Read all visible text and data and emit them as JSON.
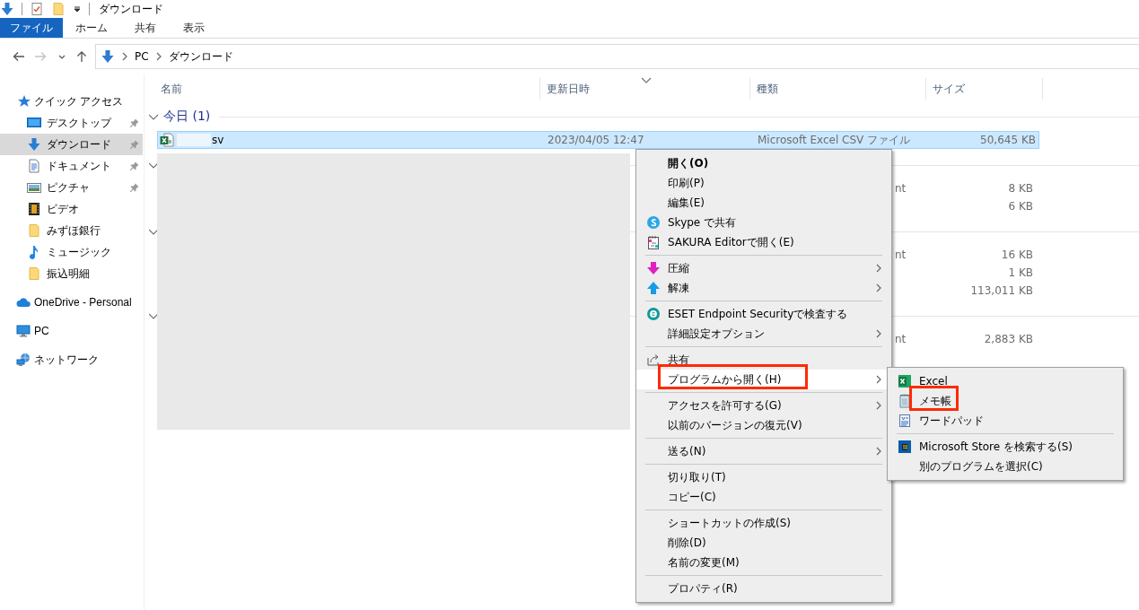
{
  "window": {
    "title": "ダウンロード"
  },
  "ribbon_tabs": [
    {
      "label": "ファイル",
      "selected": true
    },
    {
      "label": "ホーム",
      "selected": false
    },
    {
      "label": "共有",
      "selected": false
    },
    {
      "label": "表示",
      "selected": false
    }
  ],
  "navigation": [
    {
      "kind": "back",
      "disabled": false
    },
    {
      "kind": "forward",
      "disabled": true
    },
    {
      "kind": "recent",
      "disabled": false
    },
    {
      "kind": "up",
      "disabled": false
    }
  ],
  "address_bar": {
    "path": [
      "PC",
      "ダウンロード"
    ]
  },
  "sidebar": {
    "items": [
      {
        "label": "クイック アクセス",
        "selected": false,
        "children": [
          {
            "label": "デスクトップ",
            "selected": false,
            "pinned": true
          },
          {
            "label": "ダウンロード",
            "selected": true,
            "pinned": true
          },
          {
            "label": "ドキュメント",
            "selected": false,
            "pinned": true
          },
          {
            "label": "ピクチャ",
            "selected": false,
            "pinned": true
          },
          {
            "label": "ビデオ",
            "selected": false,
            "pinned": false
          },
          {
            "label": "みずほ銀行",
            "selected": false,
            "pinned": false
          },
          {
            "label": "ミュージック",
            "selected": false,
            "pinned": false
          },
          {
            "label": "振込明細",
            "selected": false,
            "pinned": false
          }
        ]
      },
      {
        "label": "OneDrive - Personal",
        "selected": false
      },
      {
        "label": "PC",
        "selected": false
      },
      {
        "label": "ネットワーク",
        "selected": false
      }
    ]
  },
  "table": {
    "columns": [
      "名前",
      "更新日時",
      "種類",
      "サイズ"
    ],
    "groups": [
      {
        "label": "今日 (1)",
        "expanded": true,
        "files": [
          {
            "kind": "full",
            "name": "sv",
            "modified": "2023/04/05 12:47",
            "type": "Microsoft Excel CSV ファイル",
            "size": "50,645 KB",
            "selected": true
          }
        ]
      },
      {
        "expanded": true,
        "files": [
          {
            "kind": "partial",
            "type": "nt",
            "size": "8 KB"
          },
          {
            "kind": "partial",
            "size": "6 KB"
          }
        ]
      },
      {
        "expanded": true,
        "files": [
          {
            "kind": "partial",
            "type": "nt",
            "size": "16 KB"
          },
          {
            "kind": "partial",
            "size": "1 KB"
          },
          {
            "kind": "partial",
            "size": "113,011 KB"
          }
        ]
      },
      {
        "expanded": true,
        "files": [
          {
            "kind": "partial",
            "type": "nt",
            "size": "2,883 KB"
          }
        ]
      }
    ]
  },
  "context_menu": {
    "items": [
      {
        "kind": "item",
        "label": "開く(O)",
        "default": true,
        "submenu": false,
        "hovered": false,
        "annotated": false
      },
      {
        "kind": "item",
        "label": "印刷(P)",
        "default": false,
        "submenu": false,
        "hovered": false,
        "annotated": false
      },
      {
        "kind": "item",
        "label": "編集(E)",
        "default": false,
        "submenu": false,
        "hovered": false,
        "annotated": false
      },
      {
        "kind": "item",
        "label": "Skype で共有",
        "default": false,
        "submenu": false,
        "hovered": false,
        "annotated": false
      },
      {
        "kind": "item",
        "label": "SAKURA Editorで開く(E)",
        "default": false,
        "submenu": false,
        "hovered": false,
        "annotated": false
      },
      {
        "kind": "separator"
      },
      {
        "kind": "item",
        "label": "圧縮",
        "default": false,
        "submenu": true,
        "hovered": false,
        "annotated": false
      },
      {
        "kind": "item",
        "label": "解凍",
        "default": false,
        "submenu": true,
        "hovered": false,
        "annotated": false
      },
      {
        "kind": "separator"
      },
      {
        "kind": "item",
        "label": "ESET Endpoint Securityで検査する",
        "default": false,
        "submenu": false,
        "hovered": false,
        "annotated": false
      },
      {
        "kind": "item",
        "label": "詳細設定オプション",
        "default": false,
        "submenu": true,
        "hovered": false,
        "annotated": false
      },
      {
        "kind": "separator"
      },
      {
        "kind": "item",
        "label": "共有",
        "default": false,
        "submenu": false,
        "hovered": false,
        "annotated": false
      },
      {
        "kind": "item",
        "label": "プログラムから開く(H)",
        "default": false,
        "submenu": true,
        "hovered": true,
        "annotated": true
      },
      {
        "kind": "separator"
      },
      {
        "kind": "item",
        "label": "アクセスを許可する(G)",
        "default": false,
        "submenu": true,
        "hovered": false,
        "annotated": false
      },
      {
        "kind": "item",
        "label": "以前のバージョンの復元(V)",
        "default": false,
        "submenu": false,
        "hovered": false,
        "annotated": false
      },
      {
        "kind": "separator"
      },
      {
        "kind": "item",
        "label": "送る(N)",
        "default": false,
        "submenu": true,
        "hovered": false,
        "annotated": false
      },
      {
        "kind": "separator"
      },
      {
        "kind": "item",
        "label": "切り取り(T)",
        "default": false,
        "submenu": false,
        "hovered": false,
        "annotated": false
      },
      {
        "kind": "item",
        "label": "コピー(C)",
        "default": false,
        "submenu": false,
        "hovered": false,
        "annotated": false
      },
      {
        "kind": "separator"
      },
      {
        "kind": "item",
        "label": "ショートカットの作成(S)",
        "default": false,
        "submenu": false,
        "hovered": false,
        "annotated": false
      },
      {
        "kind": "item",
        "label": "削除(D)",
        "default": false,
        "submenu": false,
        "hovered": false,
        "annotated": false
      },
      {
        "kind": "item",
        "label": "名前の変更(M)",
        "default": false,
        "submenu": false,
        "hovered": false,
        "annotated": false
      },
      {
        "kind": "separator"
      },
      {
        "kind": "item",
        "label": "プロパティ(R)",
        "default": false,
        "submenu": false,
        "hovered": false,
        "annotated": false
      }
    ]
  },
  "submenu": {
    "items": [
      {
        "kind": "item",
        "label": "Excel",
        "annotated": false
      },
      {
        "kind": "item",
        "label": "メモ帳",
        "annotated": true
      },
      {
        "kind": "item",
        "label": "ワードパッド",
        "annotated": false
      },
      {
        "kind": "separator"
      },
      {
        "kind": "item",
        "label": "Microsoft Store を検索する(S)",
        "annotated": false
      },
      {
        "kind": "item",
        "label": "別のプログラムを選択(C)",
        "annotated": false
      }
    ]
  }
}
